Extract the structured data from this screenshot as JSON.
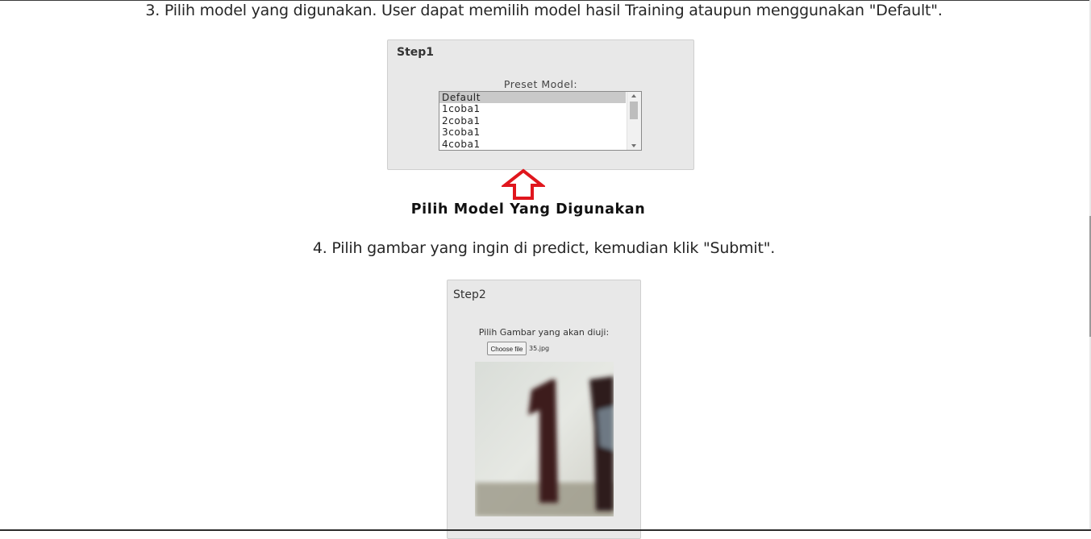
{
  "instructions": {
    "step3": "3. Pilih model yang digunakan. User dapat memilih model hasil Training ataupun menggunakan \"Default\".",
    "step4": "4. Pilih gambar yang ingin di predict, kemudian klik \"Submit\"."
  },
  "step1": {
    "title": "Step1",
    "label": "Preset Model:",
    "models": [
      "Default",
      "1coba1",
      "2coba1",
      "3coba1",
      "4coba1"
    ],
    "selected": "Default"
  },
  "caption": "Pilih Model Yang Digunakan",
  "step2": {
    "title": "Step2",
    "label": "Pilih Gambar yang akan diuji:",
    "choose_file_label": "Choose file",
    "file_name": "35.jpg"
  },
  "icons": {
    "annotation_arrow": "arrow-up-icon"
  },
  "colors": {
    "arrow": "#e0161d",
    "panel_bg": "#e8e8e8",
    "selected_row": "#c9c9c9"
  }
}
